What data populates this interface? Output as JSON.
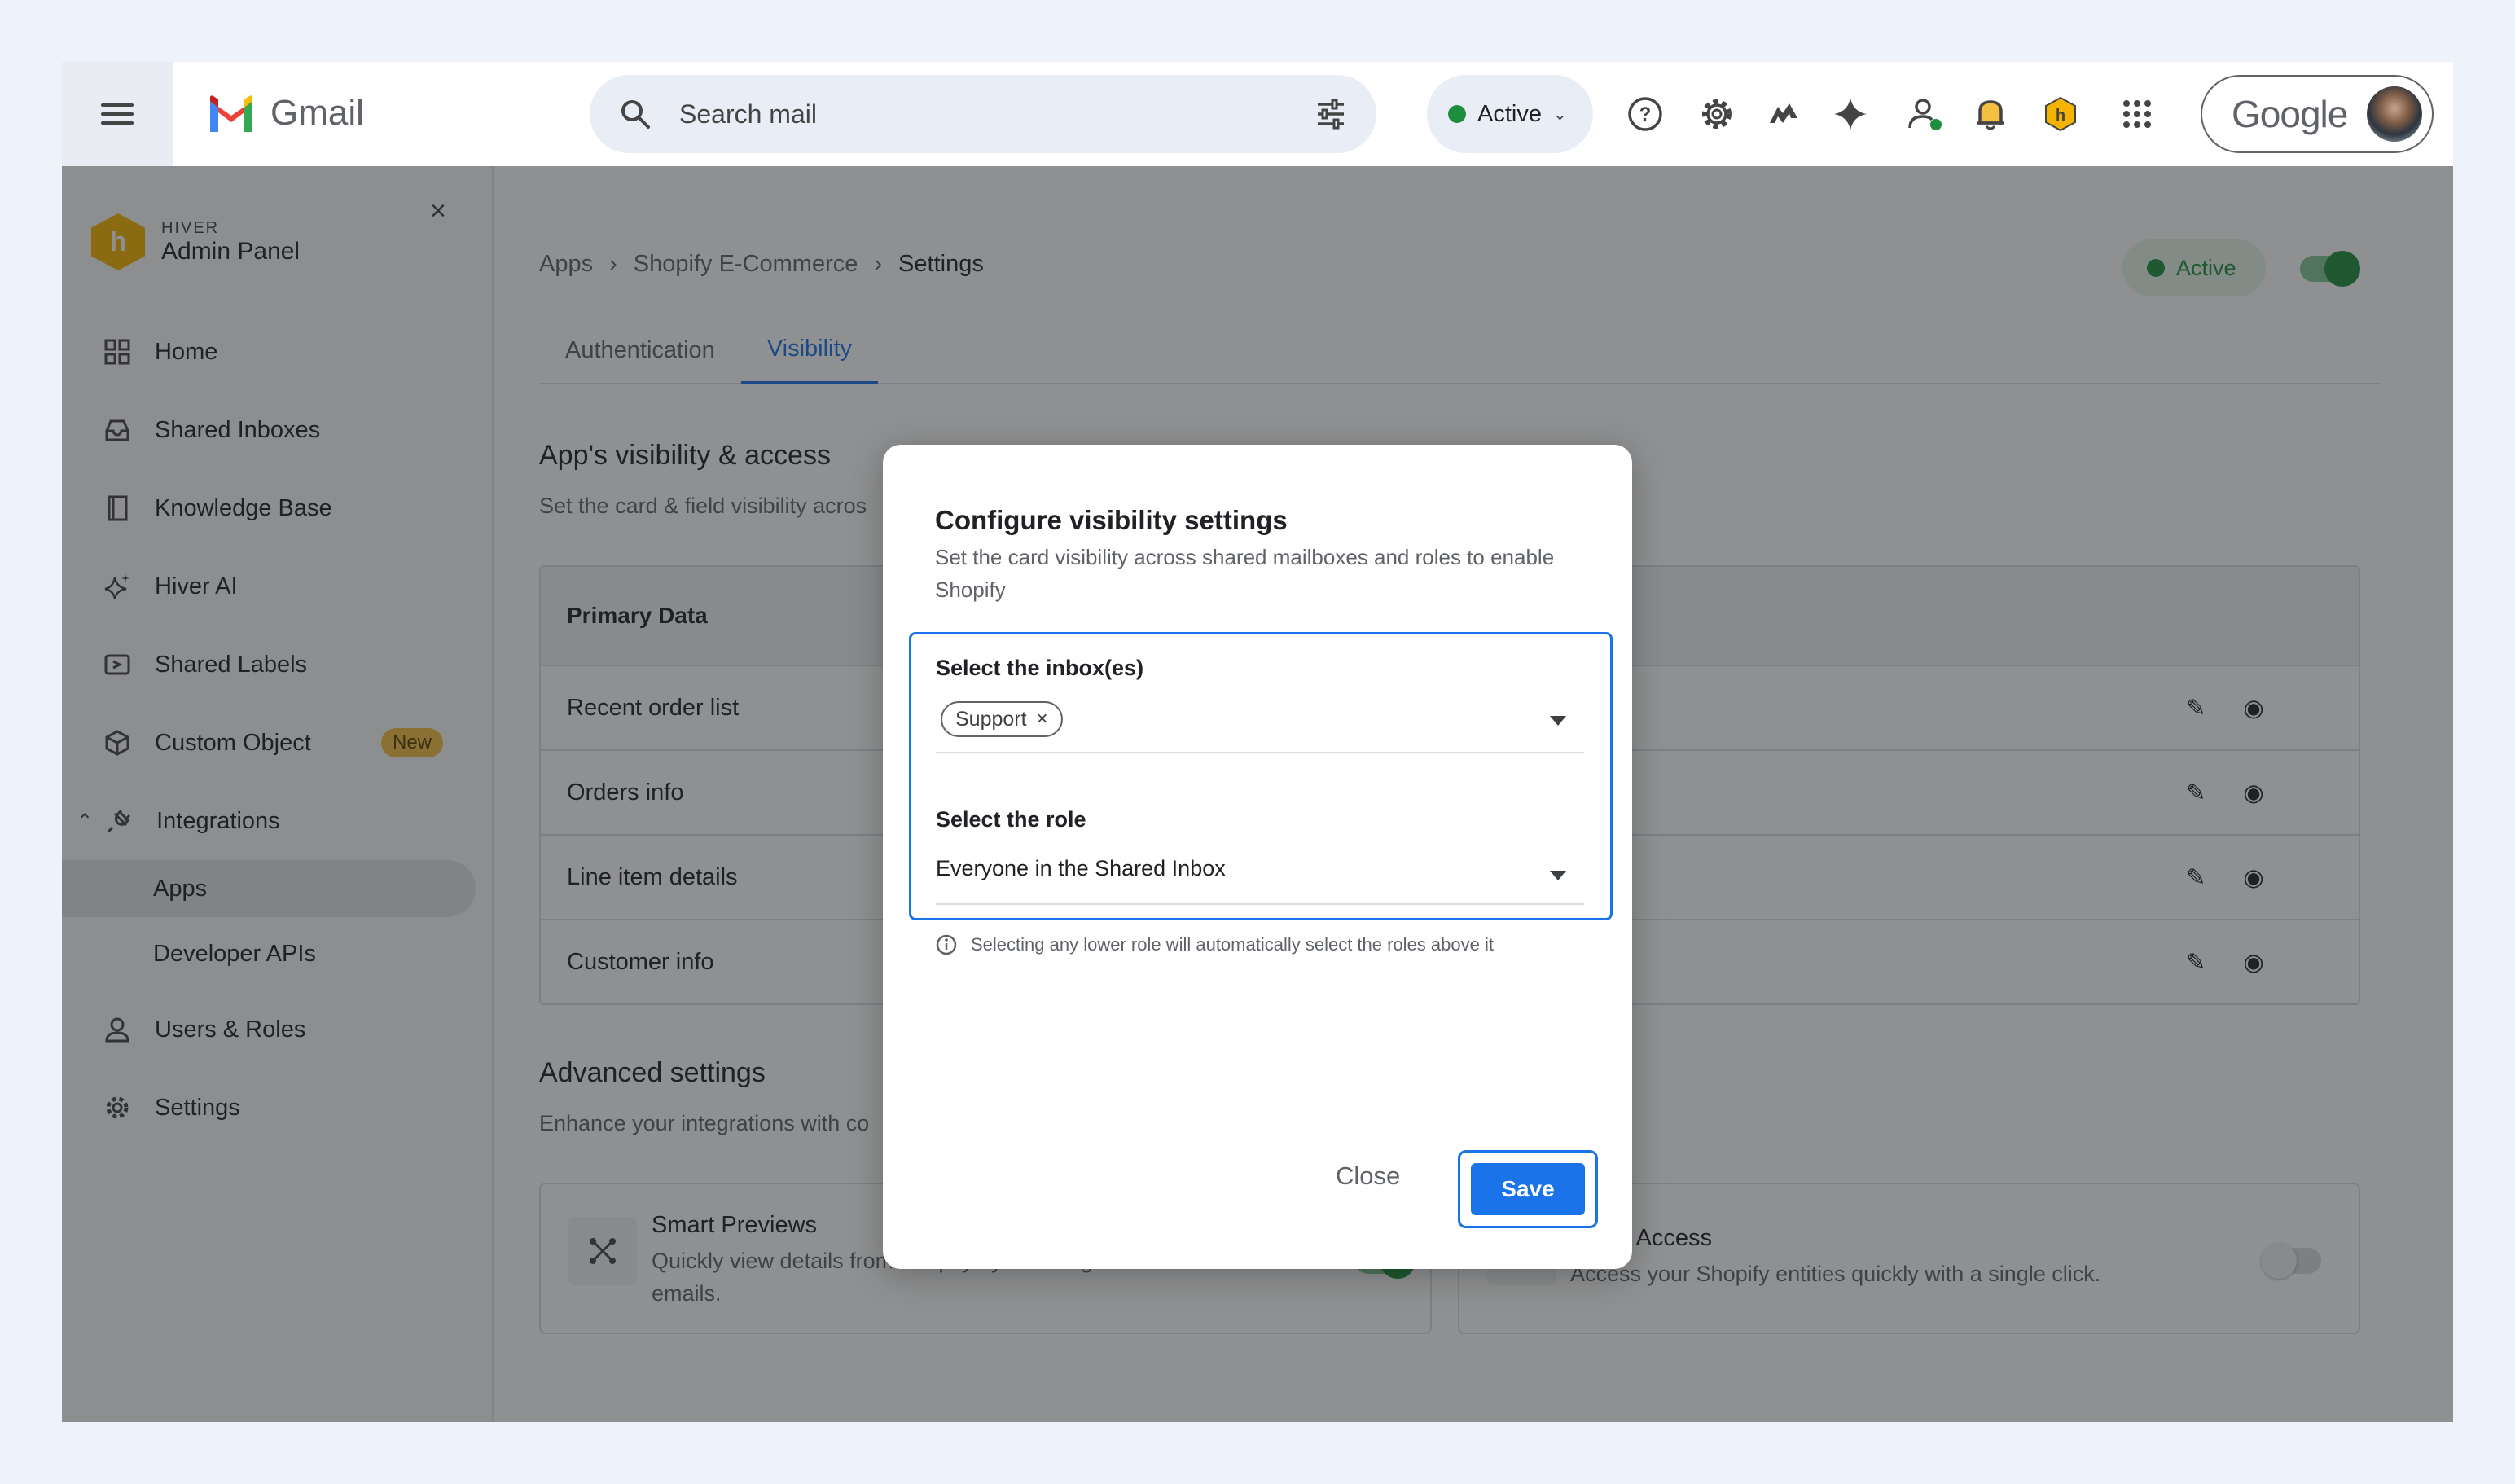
{
  "app": {
    "name": "Gmail"
  },
  "search": {
    "placeholder": "Search mail"
  },
  "status": {
    "label": "Active"
  },
  "account": {
    "brand": "Google"
  },
  "sidebar": {
    "brand_small": "HIVER",
    "brand_big": "Admin Panel",
    "items": [
      {
        "label": "Home"
      },
      {
        "label": "Shared Inboxes"
      },
      {
        "label": "Knowledge Base"
      },
      {
        "label": "Hiver AI"
      },
      {
        "label": "Shared Labels"
      },
      {
        "label": "Custom Object",
        "badge": "New"
      },
      {
        "label": "Integrations"
      },
      {
        "label": "Apps"
      },
      {
        "label": "Developer APIs"
      },
      {
        "label": "Users & Roles"
      },
      {
        "label": "Settings"
      }
    ]
  },
  "breadcrumb": [
    "Apps",
    "Shopify E-Commerce",
    "Settings"
  ],
  "app_status": {
    "label": "Active"
  },
  "tabs": [
    "Authentication",
    "Visibility"
  ],
  "visibility": {
    "title": "App's visibility & access",
    "subtitle": "Set the card & field visibility acros",
    "table_header": "Primary Data",
    "rows": [
      "Recent order list",
      "Orders info",
      "Line item details",
      "Customer info"
    ]
  },
  "advanced": {
    "title": "Advanced settings",
    "subtitle": "Enhance your integrations with co",
    "cards": [
      {
        "title": "Smart Previews",
        "desc": "Quickly view details from Shopify by hovering on entities in emails.",
        "enabled": true
      },
      {
        "title": "Quick Access",
        "desc": "Access your Shopify entities quickly with a single click.",
        "enabled": false
      }
    ]
  },
  "modal": {
    "title": "Configure visibility settings",
    "desc": "Set the card visibility across shared mailboxes and roles to enable Shopify",
    "inbox_label": "Select the inbox(es)",
    "inbox_chip": "Support",
    "role_label": "Select the role",
    "role_value": "Everyone in the Shared Inbox",
    "hint": "Selecting any lower role will automatically select the roles above it",
    "close": "Close",
    "save": "Save"
  },
  "colors": {
    "accent": "#1a73e8",
    "active_green": "#1e8e3e",
    "badge": "#f5c042"
  }
}
